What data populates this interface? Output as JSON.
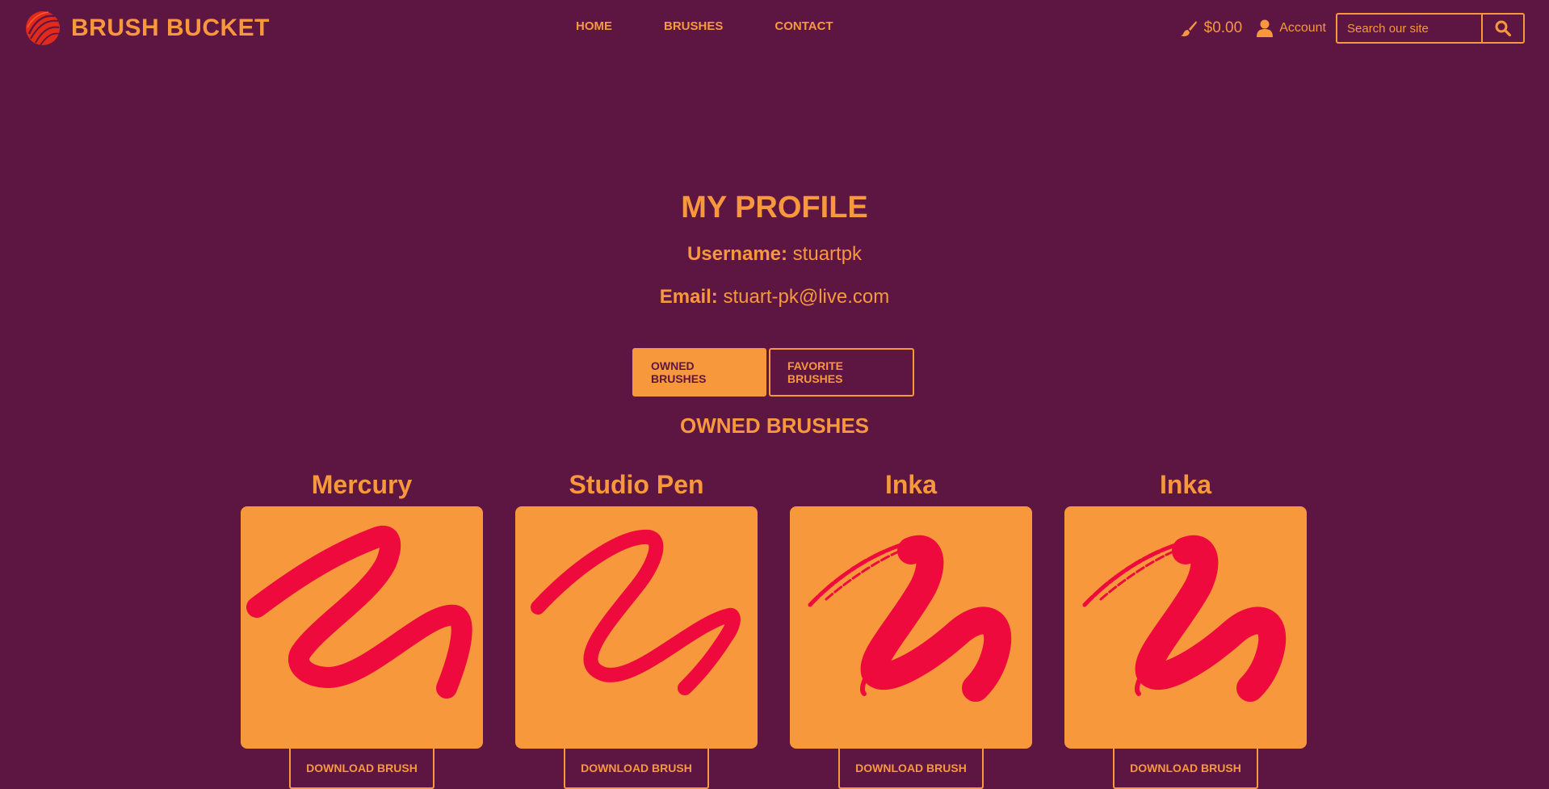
{
  "brand": {
    "name": "BRUSH BUCKET",
    "logo_icon": "brush-bucket-logo-icon"
  },
  "nav": {
    "items": [
      "HOME",
      "BRUSHES",
      "CONTACT"
    ]
  },
  "cart": {
    "icon": "paintbrush-icon",
    "amount": "$0.00"
  },
  "account": {
    "icon": "user-icon",
    "label": "Account"
  },
  "search": {
    "placeholder": "Search our site",
    "icon": "search-icon"
  },
  "profile": {
    "title": "MY PROFILE",
    "username_label": "Username:",
    "username": "stuartpk",
    "email_label": "Email:",
    "email": "stuart-pk@live.com"
  },
  "tabs": {
    "owned": "OWNED BRUSHES",
    "favorite": "FAVORITE BRUSHES"
  },
  "section_heading": "OWNED BRUSHES",
  "brushes": [
    {
      "name": "Mercury",
      "stroke_style": "solid-rough",
      "download_label": "DOWNLOAD BRUSH"
    },
    {
      "name": "Studio Pen",
      "stroke_style": "smooth-pen",
      "download_label": "DOWNLOAD BRUSH"
    },
    {
      "name": "Inka",
      "stroke_style": "dry-textured",
      "download_label": "DOWNLOAD BRUSH"
    },
    {
      "name": "Inka",
      "stroke_style": "dry-textured",
      "download_label": "DOWNLOAD BRUSH"
    }
  ],
  "colors": {
    "background": "#5d1642",
    "accent": "#f7983d",
    "stroke": "#ee0a3c"
  }
}
